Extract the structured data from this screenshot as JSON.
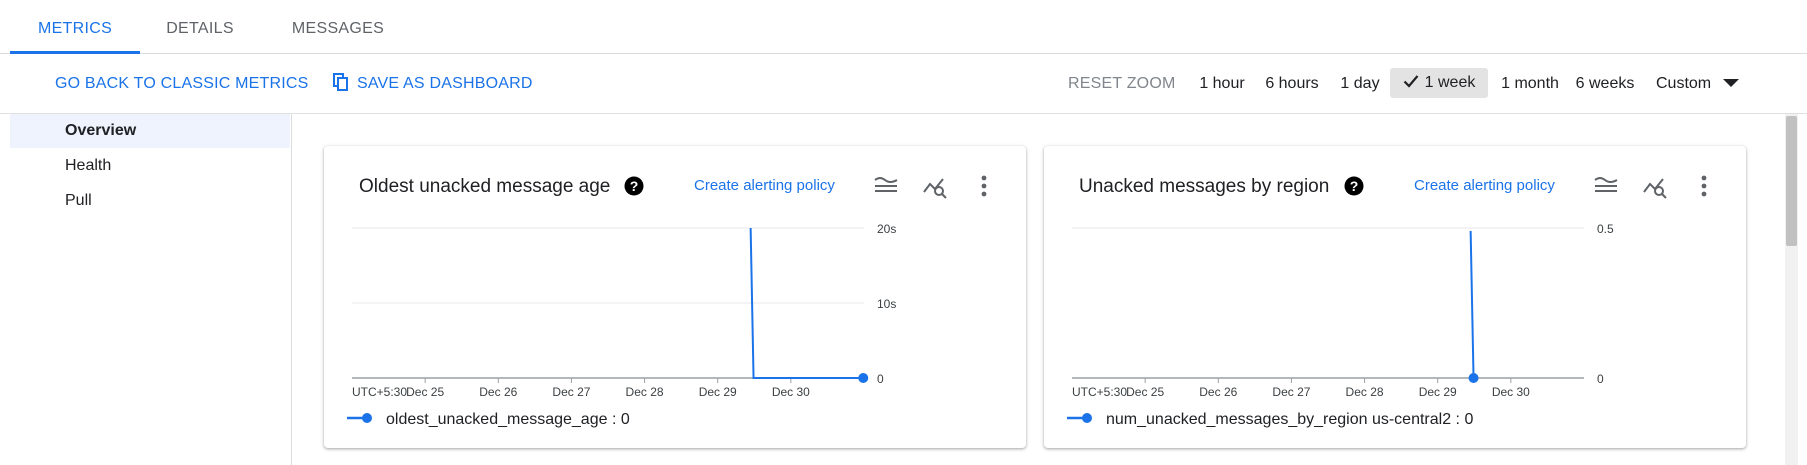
{
  "tabs": [
    "METRICS",
    "DETAILS",
    "MESSAGES"
  ],
  "active_tab": "METRICS",
  "toolbar": {
    "back_label": "GO BACK TO CLASSIC METRICS",
    "save_label": "SAVE AS DASHBOARD",
    "reset_zoom_label": "RESET ZOOM",
    "ranges": [
      "1 hour",
      "6 hours",
      "1 day",
      "1 week",
      "1 month",
      "6 weeks"
    ],
    "selected_range": "1 week",
    "custom_label": "Custom"
  },
  "sidebar": {
    "items": [
      "Overview",
      "Health",
      "Pull"
    ],
    "active": "Overview"
  },
  "cards": [
    {
      "title": "Oldest unacked message age",
      "alert_link": "Create alerting policy",
      "legend": "oldest_unacked_message_age :  0"
    },
    {
      "title": "Unacked messages by region",
      "alert_link": "Create alerting policy",
      "legend": "num_unacked_messages_by_region us-central2 :  0"
    }
  ],
  "colors": {
    "accent": "#1a73e8",
    "series": "#1a73e8",
    "grid": "#e8eaed",
    "axis": "#9aa0a6"
  },
  "chart_data": [
    {
      "type": "line",
      "title": "Oldest unacked message age",
      "x_ticks": [
        "UTC+5:30",
        "Dec 25",
        "Dec 26",
        "Dec 27",
        "Dec 28",
        "Dec 29",
        "Dec 30"
      ],
      "xlim": [
        0,
        7
      ],
      "y_ticks": [
        "0",
        "10s",
        "20s"
      ],
      "ylim": [
        0,
        20
      ],
      "grid": true,
      "legend_position": "bottom-left",
      "series": [
        {
          "name": "oldest_unacked_message_age",
          "x": [
            5.45,
            5.49,
            6.99
          ],
          "y": [
            20,
            0,
            0
          ],
          "end_marker": "last"
        }
      ]
    },
    {
      "type": "line",
      "title": "Unacked messages by region",
      "x_ticks": [
        "UTC+5:30",
        "Dec 25",
        "Dec 26",
        "Dec 27",
        "Dec 28",
        "Dec 29",
        "Dec 30"
      ],
      "xlim": [
        0,
        7
      ],
      "y_ticks": [
        "0",
        "0.5"
      ],
      "ylim": [
        0,
        0.5
      ],
      "grid": true,
      "legend_position": "bottom-left",
      "series": [
        {
          "name": "num_unacked_messages_by_region us-central2",
          "x": [
            5.45,
            5.49
          ],
          "y": [
            0.49,
            0
          ],
          "end_marker": "last"
        }
      ]
    }
  ]
}
